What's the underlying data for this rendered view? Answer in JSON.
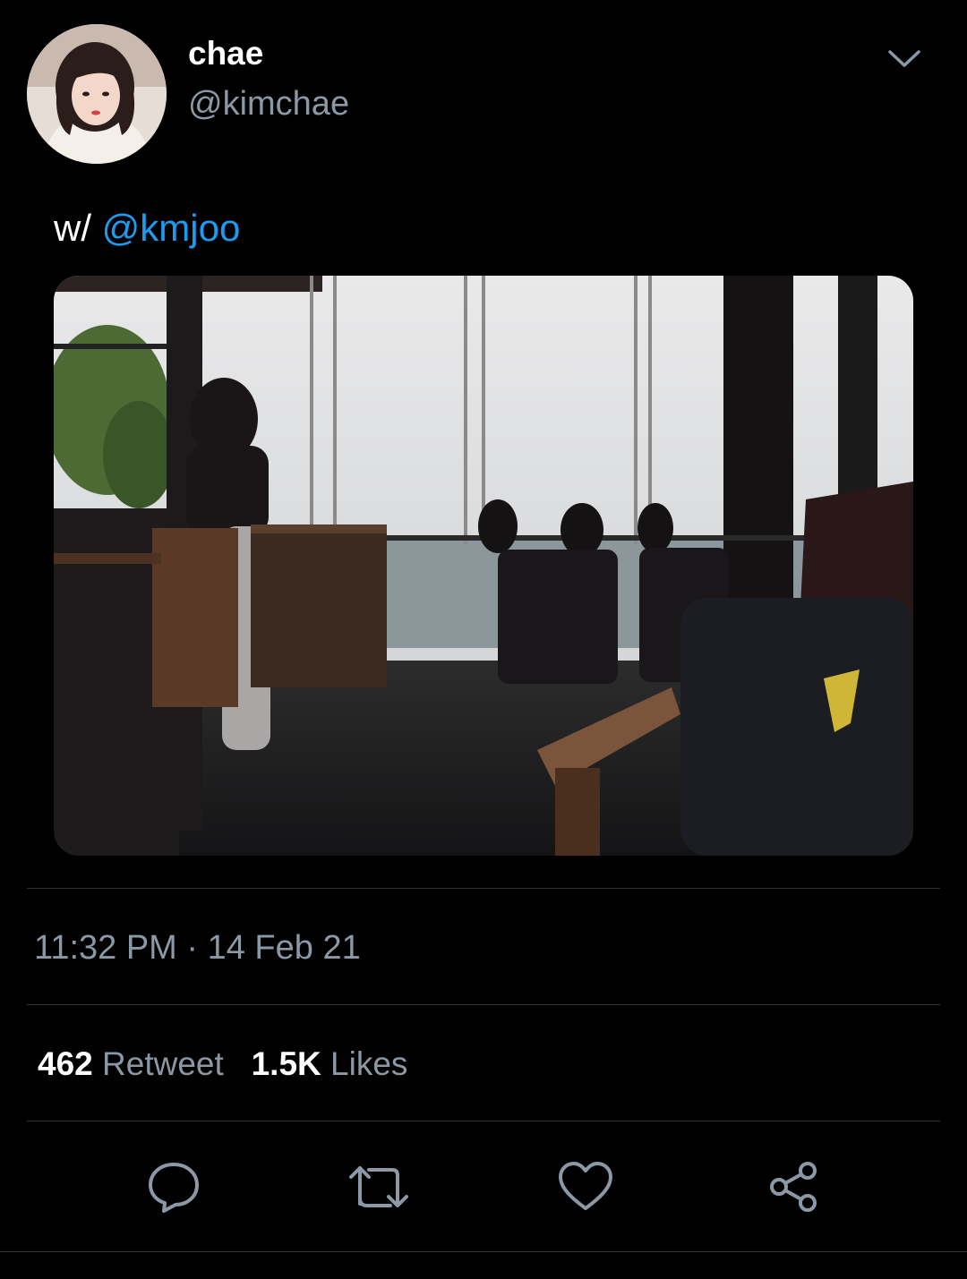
{
  "user": {
    "display_name": "chae",
    "handle": "@kimchae",
    "avatar_icon": "profile-photo"
  },
  "menu": {
    "icon": "chevron-down-icon"
  },
  "tweet": {
    "text_prefix": "w/ ",
    "mention": "@kmjoo",
    "media_icon": "photo-cafe-interior"
  },
  "meta": {
    "timestamp": "11:32 PM · 14 Feb 21"
  },
  "stats": {
    "retweets_count": "462",
    "retweets_label": "Retweet",
    "likes_count": "1.5K",
    "likes_label": "Likes"
  },
  "actions": [
    {
      "name": "reply",
      "icon": "reply-icon"
    },
    {
      "name": "retweet",
      "icon": "retweet-icon"
    },
    {
      "name": "like",
      "icon": "heart-icon"
    },
    {
      "name": "share",
      "icon": "share-icon"
    }
  ],
  "colors": {
    "background": "#000000",
    "primary_text": "#ffffff",
    "secondary_text": "#8b98a5",
    "accent": "#1d9bf0",
    "divider": "#2f3336"
  }
}
